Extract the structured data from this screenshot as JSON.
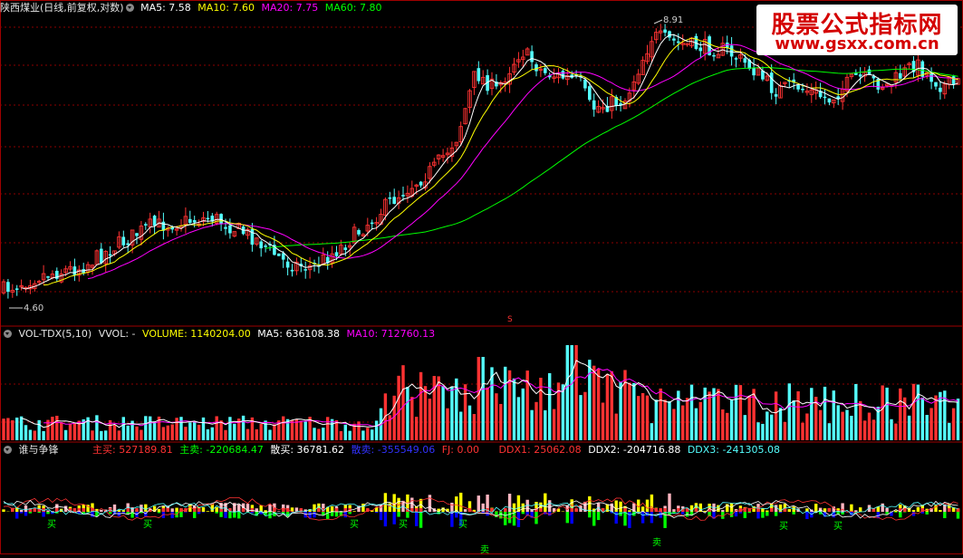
{
  "colors": {
    "bg": "#000000",
    "up": "#ff3232",
    "down": "#54ffff",
    "ma5": "#ffffff",
    "ma10": "#ffff00",
    "ma20": "#ff00ff",
    "ma60": "#00ff00",
    "grid": "#8b0000",
    "mainbuy": "#ff3232",
    "mainsell": "#00ff00",
    "retailbuy": "#ffffff",
    "retailsell": "#0000ff",
    "ddx1": "#ff3232",
    "ddx2": "#ffffff",
    "ddx3": "#54ffff"
  },
  "price_panel": {
    "title": "陕西煤业(日线,前复权,对数)",
    "ma5": "MA5: 7.58",
    "ma10": "MA10: 7.60",
    "ma20": "MA20: 7.75",
    "ma60": "MA60: 7.80",
    "high_label": "8.91",
    "low_label": "4.60",
    "marker": "S"
  },
  "volume_panel": {
    "title": "VOL-TDX(5,10)",
    "vvol": "VVOL: -",
    "volume": "VOLUME: 1140204.00",
    "ma5": "MA5: 636108.38",
    "ma10": "MA10: 712760.13"
  },
  "ddx_panel": {
    "title": "谁与争锋",
    "main_buy": "主买: 527189.81",
    "main_sell": "主卖: -220684.47",
    "retail_buy": "散买: 36781.62",
    "retail_sell": "散卖: -355549.06",
    "fj": "FJ: 0.00",
    "ddx1": "DDX1: 25062.08",
    "ddx2": "DDX2: -204716.88",
    "ddx3": "DDX3: -241305.08",
    "buy_mark": "买",
    "sell_mark": "卖"
  },
  "watermark": {
    "line1": "股票公式指标网",
    "line2": "www.gsxx.com.cn"
  }
}
